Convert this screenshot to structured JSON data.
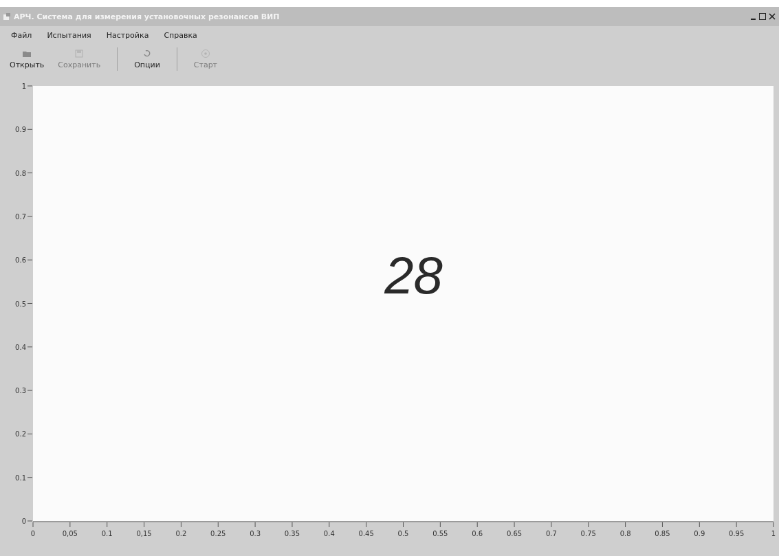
{
  "window": {
    "title": "АРЧ. Система для измерения установочных резонансов ВИП"
  },
  "menu": [
    "Файл",
    "Испытания",
    "Настройка",
    "Справка"
  ],
  "toolbar": [
    {
      "label": "Открыть",
      "kind": "open",
      "disabled": false,
      "separator_after": false
    },
    {
      "label": "Сохранить",
      "kind": "save",
      "disabled": true,
      "separator_after": true
    },
    {
      "label": "Опции",
      "kind": "options",
      "disabled": false,
      "separator_after": true
    },
    {
      "label": "Старт",
      "kind": "start",
      "disabled": true,
      "separator_after": false
    }
  ],
  "plot": {
    "overlay_text": "28",
    "chart_data": {
      "type": "line",
      "xlim": [
        0,
        1
      ],
      "ylim": [
        0,
        1
      ],
      "xticks": [
        {
          "value": 0,
          "label": "0"
        },
        {
          "value": 0.05,
          "label": "0,05"
        },
        {
          "value": 0.1,
          "label": "0.1"
        },
        {
          "value": 0.15,
          "label": "0,15"
        },
        {
          "value": 0.2,
          "label": "0.2"
        },
        {
          "value": 0.25,
          "label": "0.25"
        },
        {
          "value": 0.3,
          "label": "0.3"
        },
        {
          "value": 0.35,
          "label": "0.35"
        },
        {
          "value": 0.4,
          "label": "0.4"
        },
        {
          "value": 0.45,
          "label": "0.45"
        },
        {
          "value": 0.5,
          "label": "0.5"
        },
        {
          "value": 0.55,
          "label": "0.55"
        },
        {
          "value": 0.6,
          "label": "0.6"
        },
        {
          "value": 0.65,
          "label": "0.65"
        },
        {
          "value": 0.7,
          "label": "0.7"
        },
        {
          "value": 0.75,
          "label": "0.75"
        },
        {
          "value": 0.8,
          "label": "0.8"
        },
        {
          "value": 0.85,
          "label": "0.85"
        },
        {
          "value": 0.9,
          "label": "0.9"
        },
        {
          "value": 0.95,
          "label": "0.95"
        },
        {
          "value": 1,
          "label": "1"
        }
      ],
      "yticks": [
        {
          "value": 0,
          "label": "0"
        },
        {
          "value": 0.1,
          "label": "0.1"
        },
        {
          "value": 0.2,
          "label": "0.2"
        },
        {
          "value": 0.3,
          "label": "0.3"
        },
        {
          "value": 0.4,
          "label": "0.4"
        },
        {
          "value": 0.5,
          "label": "0.5"
        },
        {
          "value": 0.6,
          "label": "0.6"
        },
        {
          "value": 0.7,
          "label": "0.7"
        },
        {
          "value": 0.8,
          "label": "0.8"
        },
        {
          "value": 0.9,
          "label": "0.9"
        },
        {
          "value": 1,
          "label": "1"
        }
      ]
    }
  }
}
